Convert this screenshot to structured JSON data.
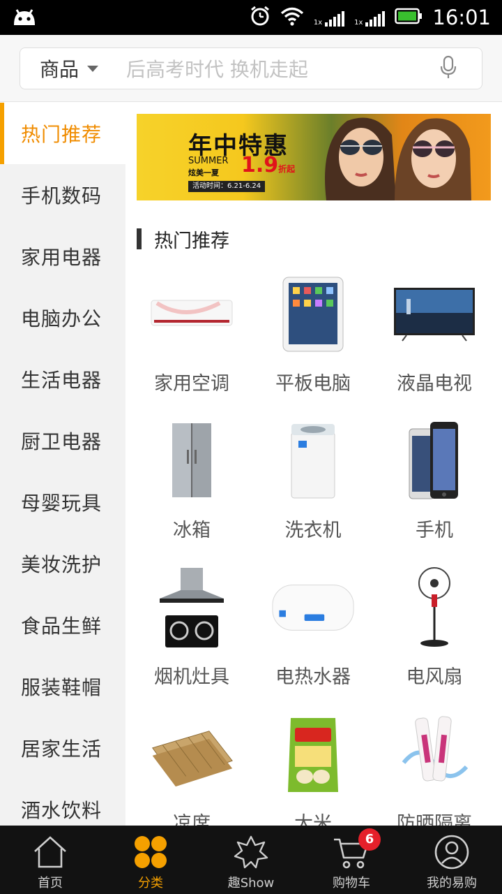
{
  "status_bar": {
    "time": "16:01",
    "sim1_tag": "1x",
    "sim2_tag": "1x",
    "icons": [
      "android-icon",
      "alarm-icon",
      "wifi-icon",
      "signal-icon",
      "battery-icon"
    ]
  },
  "search": {
    "scope_label": "商品",
    "placeholder": "后高考时代 换机走起"
  },
  "sidebar": {
    "items": [
      {
        "label": "热门推荐",
        "active": true
      },
      {
        "label": "手机数码"
      },
      {
        "label": "家用电器"
      },
      {
        "label": "电脑办公"
      },
      {
        "label": "生活电器"
      },
      {
        "label": "厨卫电器"
      },
      {
        "label": "母婴玩具"
      },
      {
        "label": "美妆洗护"
      },
      {
        "label": "食品生鲜"
      },
      {
        "label": "服装鞋帽"
      },
      {
        "label": "居家生活"
      },
      {
        "label": "酒水饮料"
      }
    ]
  },
  "banner": {
    "title": "年中特惠",
    "subtitle_en": "SUMMER",
    "subtitle_cn": "炫美一夏",
    "discount": "1.9",
    "discount_unit": "折起",
    "date": "活动时间：6.21-6.24"
  },
  "section": {
    "title": "热门推荐"
  },
  "products": [
    {
      "label": "家用空调",
      "icon": "air-conditioner-icon"
    },
    {
      "label": "平板电脑",
      "icon": "tablet-icon"
    },
    {
      "label": "液晶电视",
      "icon": "tv-icon"
    },
    {
      "label": "冰箱",
      "icon": "fridge-icon"
    },
    {
      "label": "洗衣机",
      "icon": "washing-machine-icon"
    },
    {
      "label": "手机",
      "icon": "phone-icon"
    },
    {
      "label": "烟机灶具",
      "icon": "range-hood-icon"
    },
    {
      "label": "电热水器",
      "icon": "water-heater-icon"
    },
    {
      "label": "电风扇",
      "icon": "fan-icon"
    },
    {
      "label": "凉席",
      "icon": "mat-icon"
    },
    {
      "label": "大米",
      "icon": "rice-icon"
    },
    {
      "label": "防晒隔离",
      "icon": "sunscreen-icon"
    }
  ],
  "bottom_nav": {
    "items": [
      {
        "label": "首页",
        "icon": "home-icon"
      },
      {
        "label": "分类",
        "icon": "category-icon",
        "active": true
      },
      {
        "label": "趣Show",
        "icon": "show-icon"
      },
      {
        "label": "购物车",
        "icon": "cart-icon",
        "badge": "6"
      },
      {
        "label": "我的易购",
        "icon": "profile-icon"
      }
    ]
  },
  "colors": {
    "accent": "#f5a000",
    "badge": "#e5202a",
    "nav_bg": "#121212"
  }
}
